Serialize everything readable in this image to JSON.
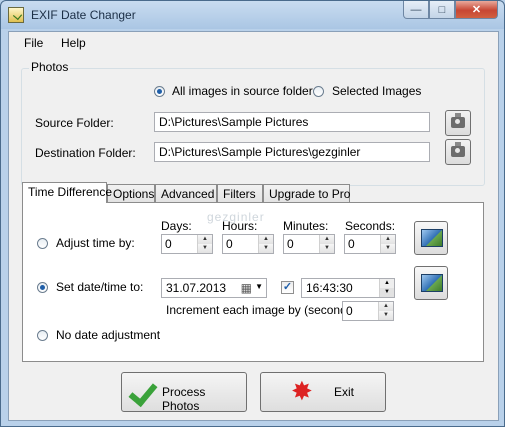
{
  "window": {
    "title": "EXIF Date Changer",
    "minimize": "—",
    "maximize": "□",
    "close": "✕"
  },
  "menu": {
    "file": "File",
    "help": "Help"
  },
  "photos": {
    "group_label": "Photos",
    "radio_all": "All images in source folder",
    "radio_selected": "Selected Images",
    "source_label": "Source Folder:",
    "source_value": "D:\\Pictures\\Sample Pictures",
    "dest_label": "Destination Folder:",
    "dest_value": "D:\\Pictures\\Sample Pictures\\gezginler"
  },
  "tabs": [
    "Time Difference",
    "Options",
    "Advanced",
    "Filters",
    "Upgrade to Pro"
  ],
  "watermark": "gezginler",
  "time_diff": {
    "adjust_label": "Adjust time by:",
    "days_label": "Days:",
    "hours_label": "Hours:",
    "minutes_label": "Minutes:",
    "seconds_label": "Seconds:",
    "days": "0",
    "hours": "0",
    "minutes": "0",
    "seconds": "0",
    "set_label": "Set date/time to:",
    "date": "31.07.2013",
    "time": "16:43:30",
    "increment_label": "Increment each image by (seconds)",
    "increment": "0",
    "no_adjust_label": "No date adjustment"
  },
  "buttons": {
    "process": "Process Photos",
    "exit": "Exit"
  },
  "colors": {
    "accent": "#1f5ea8",
    "titlebar": "#b9d1ea",
    "close": "#c74633"
  }
}
